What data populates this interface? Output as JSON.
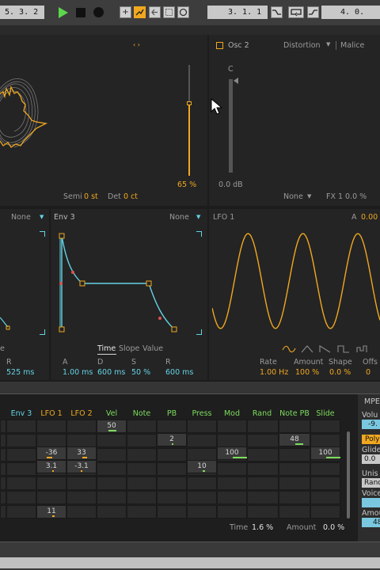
{
  "transport": {
    "position": "5. 3. 2",
    "loop_start": "3. 1. 1",
    "loop_length": "4. 0."
  },
  "osc1": {
    "semi_label": "Semi",
    "semi_value": "0 st",
    "det_label": "Det",
    "det_value": "0 ct",
    "level": "65 %",
    "level_fraction": 0.65
  },
  "osc2": {
    "name": "Osc 2",
    "effect": "Distortion",
    "effect_mode": "Malice",
    "pan_label": "C",
    "gain": "0.0 dB",
    "route": "None",
    "fx_label": "FX 1",
    "fx_value": "0.0 %"
  },
  "env2": {
    "target": "None",
    "r_label": "R",
    "r_value": "525 ms",
    "mode_partial": "e"
  },
  "env3": {
    "name": "Env 3",
    "target": "None",
    "modes": [
      "Time",
      "Slope",
      "Value"
    ],
    "a_label": "A",
    "a_value": "1.00 ms",
    "d_label": "D",
    "d_value": "600 ms",
    "s_label": "S",
    "s_value": "50 %",
    "r_label": "R",
    "r_value": "600 ms"
  },
  "lfo1": {
    "name": "LFO 1",
    "amount_header_label": "A",
    "amount_header_value": "0.00",
    "rate_label": "Rate",
    "rate_value": "1.00 Hz",
    "amount_label": "Amount",
    "amount_value": "100 %",
    "shape_label": "Shape",
    "shape_value": "0.0 %",
    "offset_label": "Offs",
    "offset_value": "0"
  },
  "matrix": {
    "mpe_label": "MPE",
    "headers": [
      "Env 3",
      "LFO 1",
      "LFO 2",
      "Vel",
      "Note",
      "PB",
      "Press",
      "Mod",
      "Rand",
      "Note PB",
      "Slide"
    ],
    "values": {
      "vel_row0": "50",
      "pb_row1": "2",
      "notepb_row1": "48",
      "lfo1_row2": "-36",
      "lfo2_row2": "33",
      "mod_row2": "100",
      "slide_row2": "100",
      "lfo1_row3": "3.1",
      "lfo2_row3": "-3.1",
      "press_row3": "10",
      "lfo1_row6": "11"
    },
    "time_label": "Time",
    "time_value": "1.6 %",
    "amount_label": "Amount",
    "amount_value": "0.0 %"
  },
  "right_panel": {
    "volume_label": "Volu",
    "volume_value": "-9.",
    "poly_label": "Poly",
    "glide_label": "Glide",
    "glide_value": "0.0",
    "unison_label": "Unis",
    "unison_value": "Rand",
    "voices_label": "Voice",
    "amount_label": "Amou",
    "amount_value": "48"
  },
  "colors": {
    "orange": "#f0a820",
    "cyan": "#64d2e4",
    "green": "#7cdc5c",
    "panel": "#242424"
  }
}
